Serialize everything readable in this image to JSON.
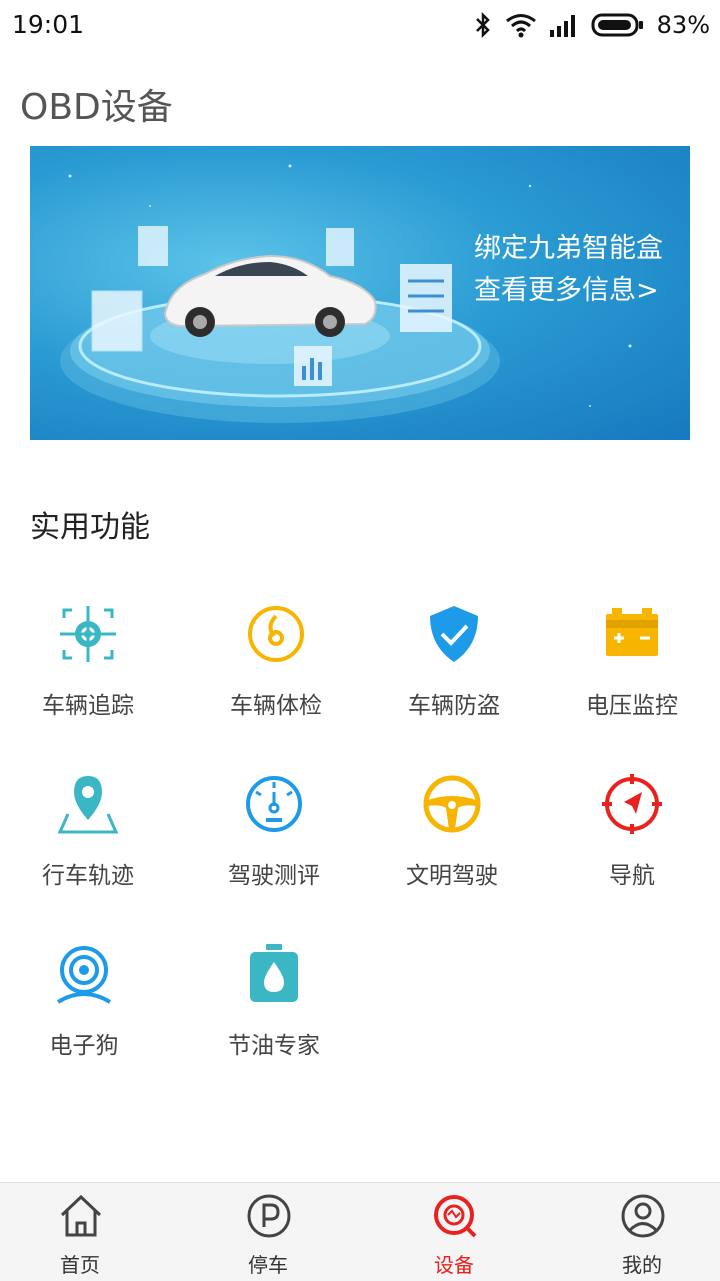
{
  "status_bar": {
    "time": "19:01",
    "battery": "83%"
  },
  "page": {
    "title": "OBD设备"
  },
  "banner": {
    "line1": "绑定九弟智能盒",
    "line2": "查看更多信息>"
  },
  "section": {
    "title": "实用功能"
  },
  "features": [
    {
      "label": "车辆追踪",
      "icon": "crosshair-target-icon",
      "color": "#3bb6c4"
    },
    {
      "label": "车辆体检",
      "icon": "gauge-dial-icon",
      "color": "#f7b500"
    },
    {
      "label": "车辆防盗",
      "icon": "shield-check-icon",
      "color": "#1e9be8"
    },
    {
      "label": "电压监控",
      "icon": "battery-icon",
      "color": "#f7b500"
    },
    {
      "label": "行车轨迹",
      "icon": "map-pin-icon",
      "color": "#3bb6c4"
    },
    {
      "label": "驾驶测评",
      "icon": "speedometer-icon",
      "color": "#1e9be8"
    },
    {
      "label": "文明驾驶",
      "icon": "steering-wheel-icon",
      "color": "#f7b500"
    },
    {
      "label": "导航",
      "icon": "compass-icon",
      "color": "#e8231f"
    },
    {
      "label": "电子狗",
      "icon": "camera-eye-icon",
      "color": "#1e9be8"
    },
    {
      "label": "节油专家",
      "icon": "fuel-drop-icon",
      "color": "#3bb6c4"
    }
  ],
  "nav": [
    {
      "label": "首页",
      "icon": "home-icon"
    },
    {
      "label": "停车",
      "icon": "parking-icon"
    },
    {
      "label": "设备",
      "icon": "device-search-icon",
      "active": true
    },
    {
      "label": "我的",
      "icon": "user-icon"
    }
  ],
  "colors": {
    "accent": "#e8231f",
    "teal": "#3bb6c4",
    "blue": "#1e9be8",
    "yellow": "#f7b500"
  }
}
